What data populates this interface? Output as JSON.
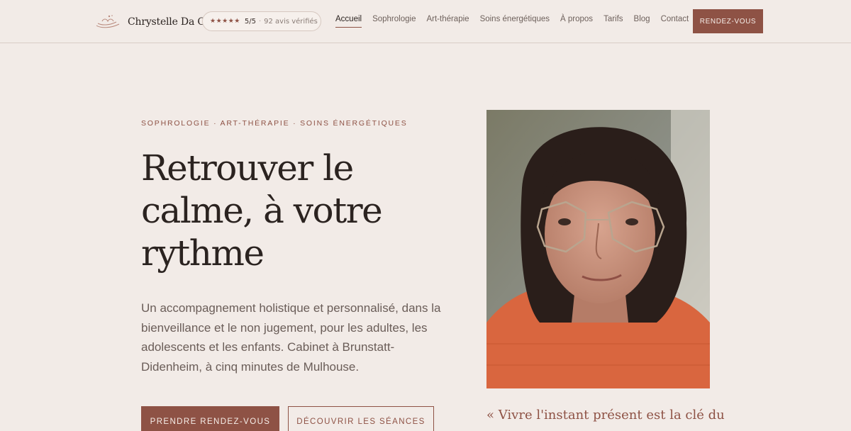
{
  "header": {
    "brand_name": "Chrystelle Da Co",
    "rating": {
      "stars": "★★★★★",
      "score": "5/5",
      "separator": "·",
      "count": "92 avis vérifiés"
    },
    "nav": [
      {
        "label": "Accueil",
        "active": true
      },
      {
        "label": "Sophrologie",
        "active": false
      },
      {
        "label": "Art-thérapie",
        "active": false
      },
      {
        "label": "Soins énergétiques",
        "active": false
      },
      {
        "label": "À propos",
        "active": false
      },
      {
        "label": "Tarifs",
        "active": false
      },
      {
        "label": "Blog",
        "active": false
      },
      {
        "label": "Contact",
        "active": false
      }
    ],
    "cta_label": "RENDEZ-VOUS"
  },
  "hero": {
    "eyebrow": "SOPHROLOGIE · ART-THÉRAPIE · SOINS ÉNERGÉTIQUES",
    "title": "Retrouver le calme, à votre rythme",
    "description": "Un accompagnement holistique et personnalisé, dans la bienveillance et le non jugement, pour les adultes, les adolescents et les enfants. Cabinet à Brunstatt-Didenheim, à cinq minutes de Mulhouse.",
    "primary_button": "PRENDRE RENDEZ-VOUS",
    "secondary_button": "DÉCOUVRIR LES SÉANCES"
  },
  "portrait": {
    "quote": "« Vivre l'instant présent est la clé du"
  },
  "colors": {
    "background": "#f2ebe7",
    "accent": "#8e5245",
    "text": "#2b2320",
    "muted_text": "#6a5d58"
  }
}
